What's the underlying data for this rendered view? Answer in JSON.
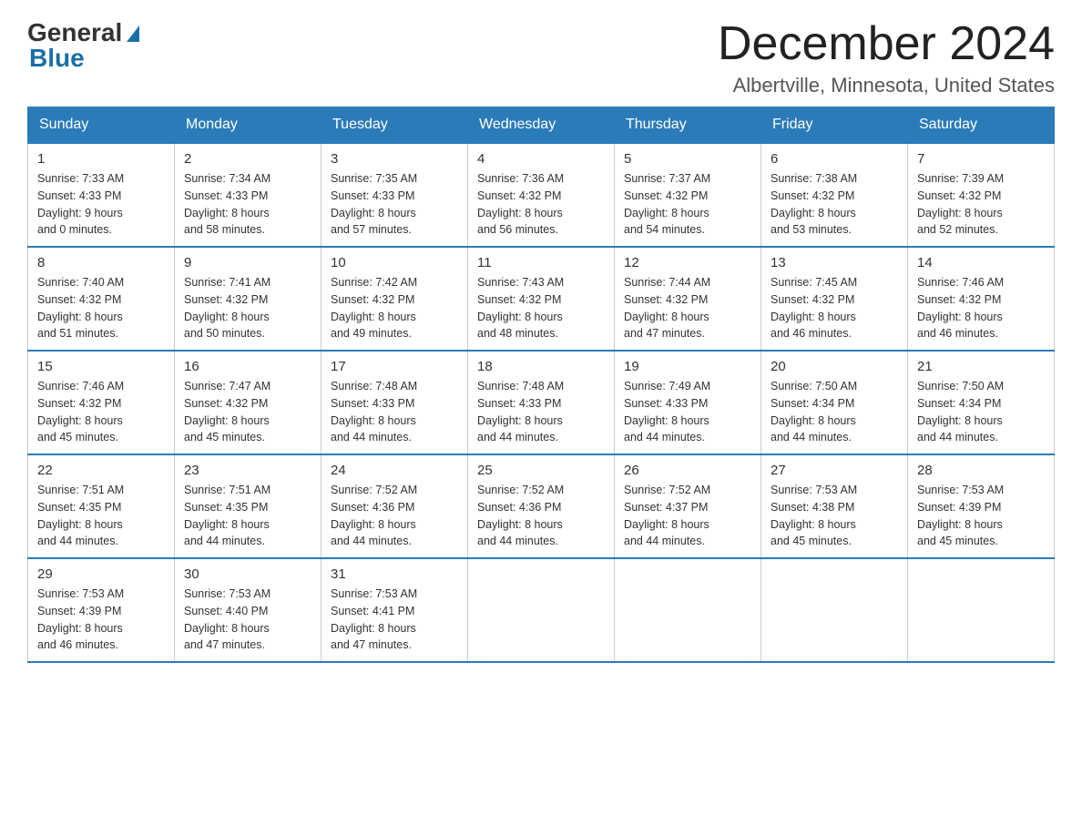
{
  "logo": {
    "general": "General",
    "blue": "Blue"
  },
  "header": {
    "month_title": "December 2024",
    "location": "Albertville, Minnesota, United States"
  },
  "days_of_week": [
    "Sunday",
    "Monday",
    "Tuesday",
    "Wednesday",
    "Thursday",
    "Friday",
    "Saturday"
  ],
  "weeks": [
    [
      {
        "day": "1",
        "sunrise": "7:33 AM",
        "sunset": "4:33 PM",
        "daylight": "9 hours and 0 minutes."
      },
      {
        "day": "2",
        "sunrise": "7:34 AM",
        "sunset": "4:33 PM",
        "daylight": "8 hours and 58 minutes."
      },
      {
        "day": "3",
        "sunrise": "7:35 AM",
        "sunset": "4:33 PM",
        "daylight": "8 hours and 57 minutes."
      },
      {
        "day": "4",
        "sunrise": "7:36 AM",
        "sunset": "4:32 PM",
        "daylight": "8 hours and 56 minutes."
      },
      {
        "day": "5",
        "sunrise": "7:37 AM",
        "sunset": "4:32 PM",
        "daylight": "8 hours and 54 minutes."
      },
      {
        "day": "6",
        "sunrise": "7:38 AM",
        "sunset": "4:32 PM",
        "daylight": "8 hours and 53 minutes."
      },
      {
        "day": "7",
        "sunrise": "7:39 AM",
        "sunset": "4:32 PM",
        "daylight": "8 hours and 52 minutes."
      }
    ],
    [
      {
        "day": "8",
        "sunrise": "7:40 AM",
        "sunset": "4:32 PM",
        "daylight": "8 hours and 51 minutes."
      },
      {
        "day": "9",
        "sunrise": "7:41 AM",
        "sunset": "4:32 PM",
        "daylight": "8 hours and 50 minutes."
      },
      {
        "day": "10",
        "sunrise": "7:42 AM",
        "sunset": "4:32 PM",
        "daylight": "8 hours and 49 minutes."
      },
      {
        "day": "11",
        "sunrise": "7:43 AM",
        "sunset": "4:32 PM",
        "daylight": "8 hours and 48 minutes."
      },
      {
        "day": "12",
        "sunrise": "7:44 AM",
        "sunset": "4:32 PM",
        "daylight": "8 hours and 47 minutes."
      },
      {
        "day": "13",
        "sunrise": "7:45 AM",
        "sunset": "4:32 PM",
        "daylight": "8 hours and 46 minutes."
      },
      {
        "day": "14",
        "sunrise": "7:46 AM",
        "sunset": "4:32 PM",
        "daylight": "8 hours and 46 minutes."
      }
    ],
    [
      {
        "day": "15",
        "sunrise": "7:46 AM",
        "sunset": "4:32 PM",
        "daylight": "8 hours and 45 minutes."
      },
      {
        "day": "16",
        "sunrise": "7:47 AM",
        "sunset": "4:32 PM",
        "daylight": "8 hours and 45 minutes."
      },
      {
        "day": "17",
        "sunrise": "7:48 AM",
        "sunset": "4:33 PM",
        "daylight": "8 hours and 44 minutes."
      },
      {
        "day": "18",
        "sunrise": "7:48 AM",
        "sunset": "4:33 PM",
        "daylight": "8 hours and 44 minutes."
      },
      {
        "day": "19",
        "sunrise": "7:49 AM",
        "sunset": "4:33 PM",
        "daylight": "8 hours and 44 minutes."
      },
      {
        "day": "20",
        "sunrise": "7:50 AM",
        "sunset": "4:34 PM",
        "daylight": "8 hours and 44 minutes."
      },
      {
        "day": "21",
        "sunrise": "7:50 AM",
        "sunset": "4:34 PM",
        "daylight": "8 hours and 44 minutes."
      }
    ],
    [
      {
        "day": "22",
        "sunrise": "7:51 AM",
        "sunset": "4:35 PM",
        "daylight": "8 hours and 44 minutes."
      },
      {
        "day": "23",
        "sunrise": "7:51 AM",
        "sunset": "4:35 PM",
        "daylight": "8 hours and 44 minutes."
      },
      {
        "day": "24",
        "sunrise": "7:52 AM",
        "sunset": "4:36 PM",
        "daylight": "8 hours and 44 minutes."
      },
      {
        "day": "25",
        "sunrise": "7:52 AM",
        "sunset": "4:36 PM",
        "daylight": "8 hours and 44 minutes."
      },
      {
        "day": "26",
        "sunrise": "7:52 AM",
        "sunset": "4:37 PM",
        "daylight": "8 hours and 44 minutes."
      },
      {
        "day": "27",
        "sunrise": "7:53 AM",
        "sunset": "4:38 PM",
        "daylight": "8 hours and 45 minutes."
      },
      {
        "day": "28",
        "sunrise": "7:53 AM",
        "sunset": "4:39 PM",
        "daylight": "8 hours and 45 minutes."
      }
    ],
    [
      {
        "day": "29",
        "sunrise": "7:53 AM",
        "sunset": "4:39 PM",
        "daylight": "8 hours and 46 minutes."
      },
      {
        "day": "30",
        "sunrise": "7:53 AM",
        "sunset": "4:40 PM",
        "daylight": "8 hours and 47 minutes."
      },
      {
        "day": "31",
        "sunrise": "7:53 AM",
        "sunset": "4:41 PM",
        "daylight": "8 hours and 47 minutes."
      },
      null,
      null,
      null,
      null
    ]
  ],
  "labels": {
    "sunrise": "Sunrise:",
    "sunset": "Sunset:",
    "daylight": "Daylight:"
  }
}
